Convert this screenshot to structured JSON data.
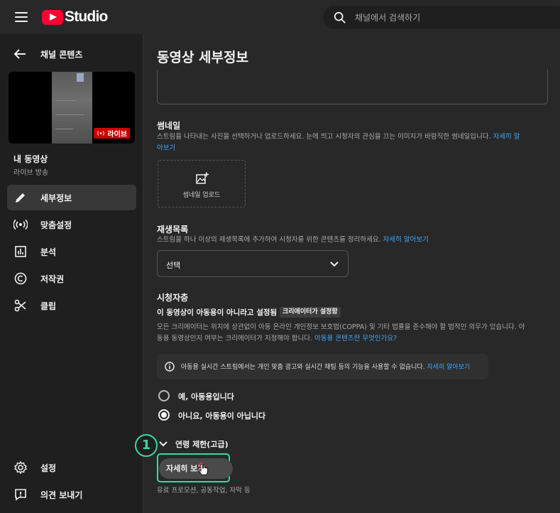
{
  "header": {
    "logo_text": "Studio",
    "search_placeholder": "채널에서 검색하기"
  },
  "sidebar": {
    "back_label": "채널 콘텐츠",
    "live_badge": "라이브",
    "video_title": "내 동영상",
    "video_subtitle": "라이브 방송",
    "nav": [
      {
        "label": "세부정보",
        "icon": "pencil-icon",
        "active": true
      },
      {
        "label": "맞춤설정",
        "icon": "broadcast-icon"
      },
      {
        "label": "분석",
        "icon": "analytics-icon"
      },
      {
        "label": "저작권",
        "icon": "copyright-icon"
      },
      {
        "label": "클립",
        "icon": "scissors-icon"
      }
    ],
    "bottom": [
      {
        "label": "설정",
        "icon": "gear-icon"
      },
      {
        "label": "의견 보내기",
        "icon": "feedback-icon"
      }
    ]
  },
  "main": {
    "page_title": "동영상 세부정보",
    "thumbnail": {
      "title": "썸네일",
      "desc_line1": "스트림을 나타내는 사진을 선택하거나 업로드하세요. 눈에 띄고 시청자의 관심을 끄는 이미지가 바람직한 썸네일입니다.",
      "link_a": "자세히 알",
      "link_b": "아보기",
      "upload_label": "썸네일 업로드"
    },
    "playlist": {
      "title": "재생목록",
      "desc": "스트림을 하나 이상의 재생목록에 추가하여 시청자를 위한 콘텐츠를 정리하세요.",
      "link": "자세히 알아보기",
      "select_value": "선택"
    },
    "audience": {
      "title": "시청자층",
      "sub_label": "이 동영상이 아동용이 아니라고 설정됨",
      "badge": "크리에이터가 설정함",
      "desc_line1": "모든 크리에이터는 위치에 상관없이 아동 온라인 개인정보 보호법(COPPA) 및 기타 법률을 준수해야 할 법적인 의무가 있습니다. 아",
      "desc_line2": "동용 동영상인지 여부는 크리에이터가 지정해야 합니다.",
      "desc_link": "아동용 콘텐츠란 무엇인가요?",
      "info_text": "아동용 실시간 스트림에서는 개인 맞춤 광고와 실시간 채팅 등의 기능을 사용할 수 없습니다.",
      "info_link": "자세히 알아보기",
      "options": [
        {
          "label": "예, 아동용입니다",
          "checked": false
        },
        {
          "label": "아니요, 아동용이 아닙니다",
          "checked": true
        }
      ]
    },
    "age": {
      "label": "연령 제한(고급)",
      "step_number": "1"
    },
    "more": {
      "button_label": "자세히 보기",
      "desc": "유료 프로모션, 공동작업, 자막 등"
    }
  },
  "colors": {
    "accent_link": "#3ea6ff",
    "brand_red": "#ff0033",
    "highlight": "#3ed6a6"
  }
}
